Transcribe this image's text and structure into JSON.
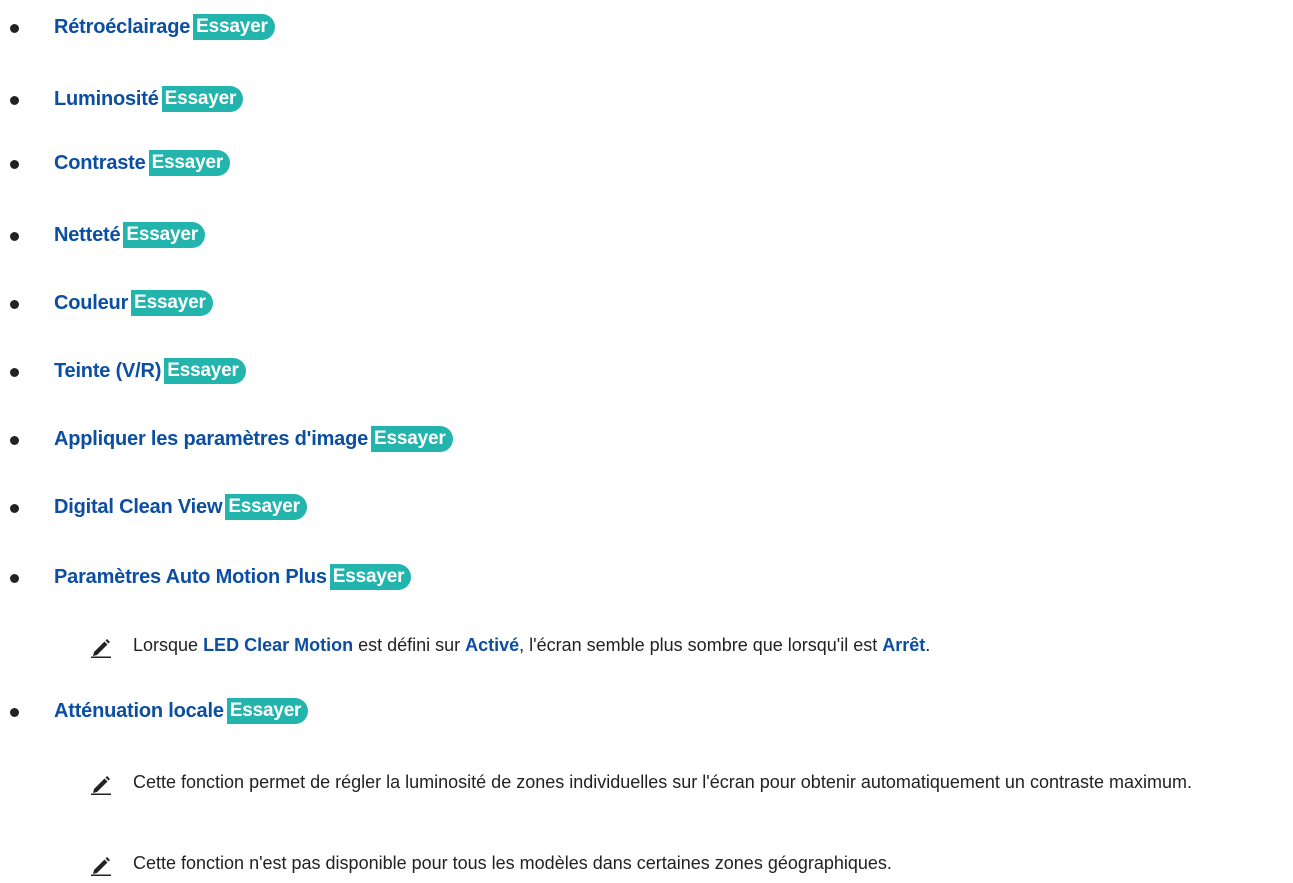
{
  "try_label": "Essayer",
  "items": [
    {
      "label": "Rétroéclairage"
    },
    {
      "label": "Luminosité"
    },
    {
      "label": "Contraste"
    },
    {
      "label": "Netteté"
    },
    {
      "label": "Couleur"
    },
    {
      "label": "Teinte (V/R)"
    },
    {
      "label": "Appliquer les paramètres d'image"
    },
    {
      "label": "Digital Clean View"
    },
    {
      "label": "Paramètres Auto Motion Plus"
    },
    {
      "label": "Atténuation locale"
    }
  ],
  "notes": {
    "motion": {
      "t1": "Lorsque ",
      "h1": "LED Clear Motion",
      "t2": " est défini sur ",
      "h2": "Activé",
      "t3": ", l'écran semble plus sombre que lorsqu'il est ",
      "h3": "Arrêt",
      "t4": "."
    },
    "local1": "Cette fonction permet de régler la luminosité de zones individuelles sur l'écran pour obtenir automatiquement un contraste maximum.",
    "local2": "Cette fonction n'est pas disponible pour tous les modèles dans certaines zones géographiques."
  },
  "colors": {
    "link": "#0b4ea2",
    "pill": "#23b5ad",
    "text": "#222222"
  }
}
